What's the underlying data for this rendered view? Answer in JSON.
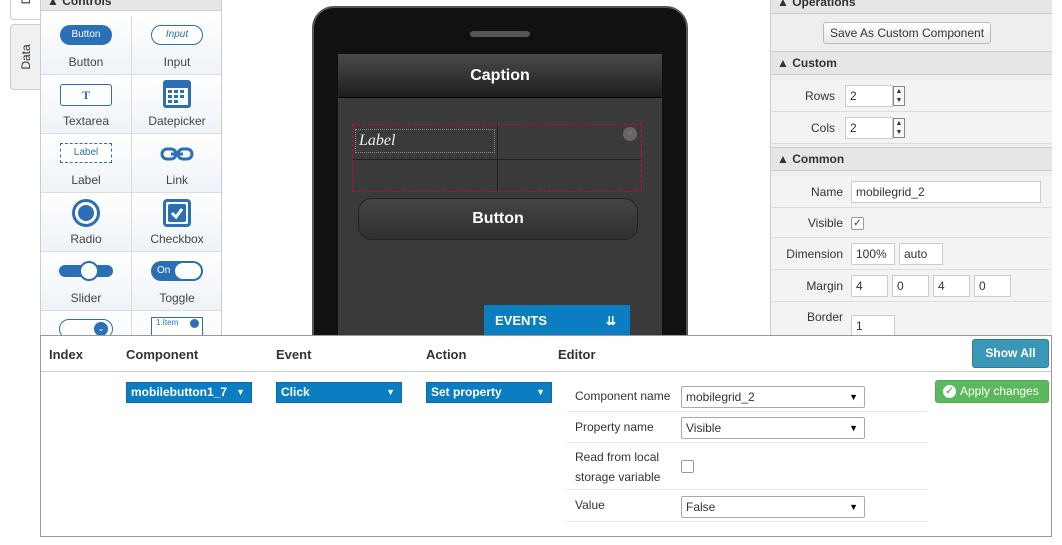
{
  "tabs": {
    "design": "D",
    "data": "Data"
  },
  "palette": {
    "header": "Controls",
    "items": [
      {
        "label": "Button",
        "icon": "button-icon",
        "text": "Button"
      },
      {
        "label": "Input",
        "icon": "input-icon",
        "text": "Input"
      },
      {
        "label": "Textarea",
        "icon": "textarea-icon",
        "text": "T"
      },
      {
        "label": "Datepicker",
        "icon": "calendar-icon"
      },
      {
        "label": "Label",
        "icon": "label-icon",
        "text": "Label"
      },
      {
        "label": "Link",
        "icon": "link-icon"
      },
      {
        "label": "Radio",
        "icon": "radio-icon"
      },
      {
        "label": "Checkbox",
        "icon": "checkbox-icon"
      },
      {
        "label": "Slider",
        "icon": "slider-icon"
      },
      {
        "label": "Toggle",
        "icon": "toggle-icon",
        "text": "On"
      },
      {
        "label": "",
        "icon": "select-icon"
      },
      {
        "label": "",
        "icon": "list-icon",
        "text": "1.Item"
      }
    ]
  },
  "canvas": {
    "caption": "Caption",
    "grid_label": "Label",
    "button": "Button",
    "events_button": "EVENTS",
    "close_glyph": "×"
  },
  "properties": {
    "operations_header": "Operations",
    "save_custom": "Save As Custom Component",
    "custom_header": "Custom",
    "rows_label": "Rows",
    "rows_value": "2",
    "cols_label": "Cols",
    "cols_value": "2",
    "common_header": "Common",
    "name_label": "Name",
    "name_value": "mobilegrid_2",
    "visible_label": "Visible",
    "dimension_label": "Dimension",
    "dimension_width": "100%",
    "dimension_height": "auto",
    "margin_label": "Margin",
    "margin": [
      "4",
      "0",
      "4",
      "0"
    ],
    "border_label": "Border",
    "border_value": "1"
  },
  "events": {
    "headers": {
      "index": "Index",
      "component": "Component",
      "event": "Event",
      "action": "Action",
      "editor": "Editor"
    },
    "show_all": "Show All",
    "row": {
      "component": "mobilebutton1_7",
      "event": "Click",
      "action": "Set property"
    },
    "editor": {
      "component_name_label": "Component name",
      "component_name_value": "mobilegrid_2",
      "property_name_label": "Property name",
      "property_name_value": "Visible",
      "read_local_label_1": "Read from local",
      "read_local_label_2": "storage variable",
      "value_label": "Value",
      "value_value": "False"
    },
    "apply": "Apply changes"
  },
  "colors": {
    "accent": "#0b7dc1",
    "apply": "#5cb85c",
    "show_all": "#3a98b6"
  }
}
